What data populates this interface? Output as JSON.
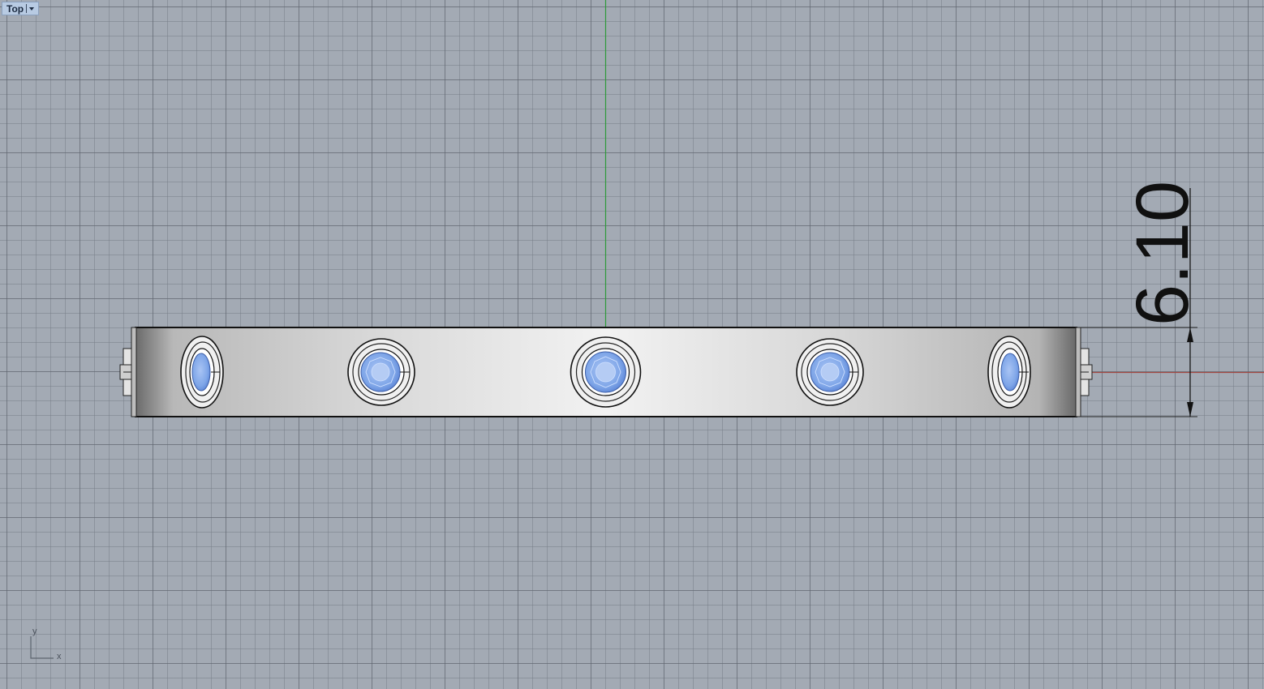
{
  "viewport": {
    "name": "Top",
    "background_color": "#a3aab4",
    "y_axis_color": "#2f9a3a",
    "x_axis_color": "#a34a44"
  },
  "dimension": {
    "value": "6.10"
  },
  "axis_icon": {
    "x_label": "x",
    "y_label": "y"
  },
  "stones": [
    {
      "type": "oval-side",
      "color": "#7fa6e8"
    },
    {
      "type": "round",
      "color": "#7fa6e8"
    },
    {
      "type": "round",
      "color": "#7fa6e8"
    },
    {
      "type": "round",
      "color": "#7fa6e8"
    },
    {
      "type": "oval-side",
      "color": "#7fa6e8"
    }
  ]
}
